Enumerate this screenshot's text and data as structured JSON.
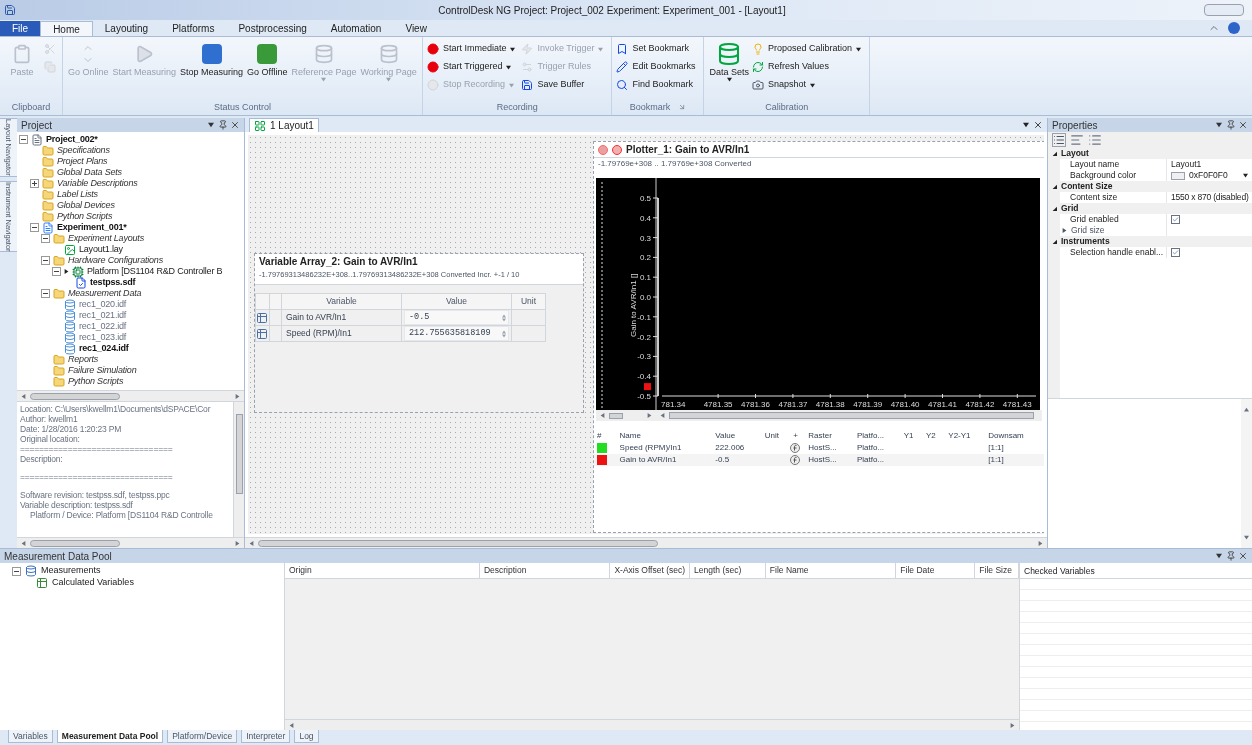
{
  "title_bar": {
    "title": "ControlDesk NG Project: Project_002 Experiment: Experiment_001 - [Layout1]"
  },
  "ribbon": {
    "tabs": [
      {
        "label": "File",
        "kind": "file",
        "selected": false
      },
      {
        "label": "Home",
        "kind": "tab",
        "selected": true
      },
      {
        "label": "Layouting",
        "kind": "tab",
        "selected": false
      },
      {
        "label": "Platforms",
        "kind": "tab",
        "selected": false
      },
      {
        "label": "Postprocessing",
        "kind": "tab",
        "selected": false
      },
      {
        "label": "Automation",
        "kind": "tab",
        "selected": false
      },
      {
        "label": "View",
        "kind": "tab",
        "selected": false
      }
    ],
    "groups": [
      {
        "label": "Clipboard",
        "columns": [
          [
            {
              "kind": "large",
              "label": "Paste",
              "disabled": true
            }
          ],
          [
            {
              "kind": "icon",
              "disabled": true
            },
            {
              "kind": "icon",
              "disabled": true
            }
          ]
        ]
      },
      {
        "label": "Status Control",
        "columns": [
          [
            {
              "kind": "large",
              "label": "Go Online",
              "disabled": true
            }
          ],
          [
            {
              "kind": "large",
              "label": "Start Measuring",
              "disabled": true
            }
          ],
          [
            {
              "kind": "large",
              "label": "Stop Measuring",
              "disabled": false
            }
          ],
          [
            {
              "kind": "large",
              "label": "Go Offline",
              "disabled": false
            }
          ],
          [
            {
              "kind": "large",
              "label": "Reference Page",
              "disabled": true,
              "dropdown": true
            }
          ],
          [
            {
              "kind": "large",
              "label": "Working Page",
              "disabled": true,
              "dropdown": true
            }
          ]
        ]
      },
      {
        "label": "Recording",
        "columns": [
          [
            {
              "kind": "small",
              "label": "Start Immediate",
              "disabled": false,
              "dropdown": true
            },
            {
              "kind": "small",
              "label": "Start Triggered",
              "disabled": false,
              "dropdown": true
            },
            {
              "kind": "small",
              "label": "Stop Recording",
              "disabled": true,
              "dropdown": true
            }
          ],
          [
            {
              "kind": "small",
              "label": "Invoke Trigger",
              "disabled": true,
              "dropdown": true
            },
            {
              "kind": "small",
              "label": "Trigger Rules",
              "disabled": true,
              "dropdown": false
            },
            {
              "kind": "small",
              "label": "Save Buffer",
              "disabled": false,
              "dropdown": false
            }
          ]
        ]
      },
      {
        "label": "Bookmark",
        "launcher": true,
        "columns": [
          [
            {
              "kind": "small",
              "label": "Set Bookmark",
              "disabled": false,
              "dropdown": false
            },
            {
              "kind": "small",
              "label": "Edit Bookmarks",
              "disabled": false,
              "dropdown": false
            },
            {
              "kind": "small",
              "label": "Find Bookmark",
              "disabled": false,
              "dropdown": false
            }
          ]
        ]
      },
      {
        "label": "Calibration",
        "columns": [
          [
            {
              "kind": "large",
              "label": "Data Sets",
              "disabled": false,
              "dropdown": true
            }
          ],
          [
            {
              "kind": "small",
              "label": "Proposed Calibration",
              "disabled": false,
              "dropdown": true
            },
            {
              "kind": "small",
              "label": "Refresh Values",
              "disabled": false,
              "dropdown": false
            },
            {
              "kind": "small",
              "label": "Snapshot",
              "disabled": false,
              "dropdown": true
            }
          ]
        ]
      }
    ]
  },
  "side_tabs": [
    "Layout Navigator",
    "Instrument Navigator"
  ],
  "project": {
    "title": "Project",
    "tree": [
      {
        "label": "Project_002*",
        "kind": "project",
        "expanded": true,
        "children": [
          {
            "label": "Specifications",
            "kind": "folder"
          },
          {
            "label": "Project Plans",
            "kind": "folder"
          },
          {
            "label": "Global Data Sets",
            "kind": "folder"
          },
          {
            "label": "Variable Descriptions",
            "kind": "folder",
            "expanded": false,
            "collapsible": true
          },
          {
            "label": "Label Lists",
            "kind": "folder"
          },
          {
            "label": "Global Devices",
            "kind": "folder"
          },
          {
            "label": "Python Scripts",
            "kind": "folder"
          },
          {
            "label": "Experiment_001*",
            "kind": "experiment",
            "expanded": true,
            "children": [
              {
                "label": "Experiment Layouts",
                "kind": "folder",
                "expanded": true,
                "children": [
                  {
                    "label": "Layout1.lay",
                    "kind": "layout"
                  }
                ]
              },
              {
                "label": "Hardware Configurations",
                "kind": "folder",
                "expanded": true,
                "children": [
                  {
                    "label": "Platform [DS1104 R&D Controller B",
                    "kind": "platform",
                    "expanded": true,
                    "children": [
                      {
                        "label": "testpss.sdf",
                        "kind": "sdf"
                      }
                    ]
                  }
                ]
              },
              {
                "label": "Measurement Data",
                "kind": "folder",
                "expanded": true,
                "children": [
                  {
                    "label": "rec1_020.idf",
                    "kind": "data",
                    "active": false
                  },
                  {
                    "label": "rec1_021.idf",
                    "kind": "data",
                    "active": false
                  },
                  {
                    "label": "rec1_022.idf",
                    "kind": "data",
                    "active": false
                  },
                  {
                    "label": "rec1_023.idf",
                    "kind": "data",
                    "active": false
                  },
                  {
                    "label": "rec1_024.idf",
                    "kind": "data",
                    "active": true
                  }
                ]
              },
              {
                "label": "Reports",
                "kind": "folder"
              },
              {
                "label": "Failure Simulation",
                "kind": "folder"
              },
              {
                "label": "Python Scripts",
                "kind": "folder"
              }
            ]
          }
        ]
      }
    ],
    "info": [
      {
        "text": "Location: C:\\Users\\kwellm1\\Documents\\dSPACE\\Cor"
      },
      {
        "text": "Author: kwellm1"
      },
      {
        "text": "Date: 1/28/2016 1:20:23 PM"
      },
      {
        "text": "Original location:"
      },
      {
        "text": "================================"
      },
      {
        "text": "Description:"
      },
      {
        "text": "================================",
        "space_before": true
      },
      {
        "text": "Software revision: testpss.sdf, testpss.ppc",
        "space_before": true
      },
      {
        "text": "Variable description: testpss.sdf"
      },
      {
        "text": "Platform / Device: Platform [DS1104 R&D Controlle",
        "indent": true
      }
    ]
  },
  "layout_tab": {
    "label": "1 Layout1"
  },
  "variable_array": {
    "title": "Variable Array_2:  Gain to AVR/In1",
    "subtitle": "-1.79769313486232E+308..1.79769313486232E+308  Converted Incr. +-1 / 10",
    "columns": [
      "Variable",
      "Value",
      "Unit"
    ],
    "rows": [
      {
        "variable": "Gain to AVR/In1",
        "value": "-0.5"
      },
      {
        "variable": "Speed (RPM)/In1",
        "value": "212.755635818109"
      }
    ]
  },
  "plotter": {
    "title": "Plotter_1:  Gain to AVR/In1",
    "subtitle": "-1.79769e+308 .. 1.79769e+308  Converted",
    "cut_tick_label": "781.34",
    "chart_data": {
      "type": "line",
      "ylabel": "Gain to AVR/In1 []",
      "ylim": [
        -0.5,
        0.5
      ],
      "yticks": [
        0.5,
        0.4,
        0.3,
        0.2,
        0.1,
        {
          "value": 0,
          "label": "0.0"
        },
        -0.1,
        -0.2,
        -0.3,
        -0.4,
        -0.5
      ],
      "xlim": [
        4781.335,
        4781.435
      ],
      "xticks": [
        4781.35,
        4781.36,
        4781.37,
        4781.38,
        4781.39,
        {
          "value": 4781.4,
          "label": "4781.40"
        },
        4781.41,
        4781.42,
        4781.43
      ]
    },
    "legend_columns": [
      "#",
      "Name",
      "Value",
      "Unit",
      "+",
      "Raster",
      "Platfo...",
      "Y1",
      "Y2",
      "Y2-Y1",
      "Downsam"
    ],
    "legend": [
      {
        "name": "Speed (RPM)/In1",
        "value": "222.006",
        "raster": "HostS...",
        "platform": "Platfo...",
        "downsample": "[1:1]",
        "color": "#22dd22"
      },
      {
        "name": "Gain to AVR/In1",
        "value": "-0.5",
        "raster": "HostS...",
        "platform": "Platfo...",
        "downsample": "[1:1]",
        "color": "#ee1111"
      }
    ]
  },
  "properties": {
    "title": "Properties",
    "categories": [
      {
        "label": "Layout",
        "expanded": true,
        "rows": [
          {
            "kind": "text",
            "name": "Layout name",
            "value": "Layout1"
          },
          {
            "kind": "color",
            "name": "Background color",
            "value": "0xF0F0F0",
            "color": "#f0f0f0"
          }
        ]
      },
      {
        "label": "Content Size",
        "expanded": true,
        "rows": [
          {
            "kind": "dropdown",
            "name": "Content size",
            "value": "1550 x 870 (disabled)"
          }
        ]
      },
      {
        "label": "Grid",
        "expanded": true,
        "rows": [
          {
            "kind": "check",
            "name": "Grid enabled",
            "checked": true
          },
          {
            "kind": "group",
            "name": "Grid size",
            "expanded": false
          }
        ]
      },
      {
        "label": "Instruments",
        "expanded": true,
        "rows": [
          {
            "kind": "check",
            "name": "Selection handle enabl...",
            "checked": true
          }
        ]
      }
    ]
  },
  "data_pool": {
    "title": "Measurement Data Pool",
    "tree": [
      {
        "label": "Measurements",
        "expanded": true,
        "children": [
          {
            "label": "Calculated Variables"
          }
        ]
      }
    ],
    "columns": [
      "Origin",
      "Description",
      "X-Axis Offset (sec)",
      "Length (sec)",
      "File Name",
      "File Date",
      "File Size"
    ],
    "checked_title": "Checked Variables"
  },
  "bottom_tabs": [
    {
      "label": "Variables",
      "selected": false
    },
    {
      "label": "Measurement Data Pool",
      "selected": true
    },
    {
      "label": "Platform/Device",
      "selected": false
    },
    {
      "label": "Interpreter",
      "selected": false
    },
    {
      "label": "Log",
      "selected": false
    }
  ]
}
